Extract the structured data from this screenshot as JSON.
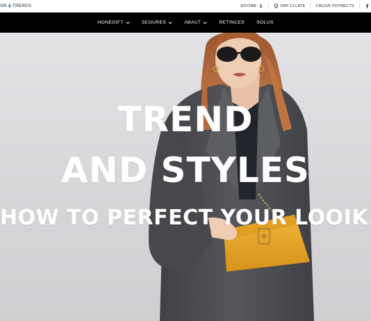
{
  "header": {
    "logo_left": "ON",
    "logo_right": "TRENDS",
    "links": [
      {
        "label": "HOTIME",
        "icon": "dollar-icon"
      },
      {
        "label": "ORF CLLATE",
        "icon": "pin-icon"
      },
      {
        "label": "CACIUF FOTNECTS",
        "icon": ""
      },
      {
        "label": "",
        "icon": "facebook-icon"
      }
    ]
  },
  "nav": {
    "items": [
      {
        "label": "HONEGIFT",
        "dropdown": true
      },
      {
        "label": "SEOURES",
        "dropdown": true
      },
      {
        "label": "ABAUT",
        "dropdown": true
      },
      {
        "label": "RETINCES",
        "dropdown": false
      },
      {
        "label": "SOLUS",
        "dropdown": false
      }
    ]
  },
  "hero": {
    "line1": "TREND",
    "line2": "AND STYLES",
    "subtitle": "HOW TO PERFECT YOUR LOOIK."
  },
  "colors": {
    "navbar": "#000000",
    "hero_bg": "#d9d9dc",
    "coat": "#4a4c50",
    "bag": "#e7a52a",
    "hair": "#b86a3a"
  }
}
